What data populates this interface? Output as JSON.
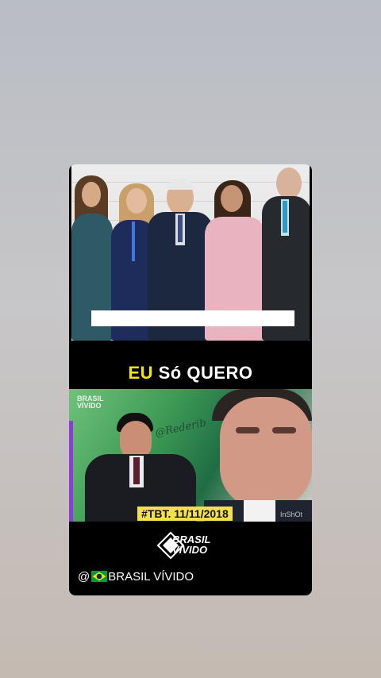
{
  "headline": {
    "part1": "EU",
    "part2": "Só",
    "part3": "QUERO"
  },
  "overlay": {
    "watermark_handle": "@Rederib",
    "date_tag": "#TBT.  11/11/2018",
    "corner_mark": "InShOt",
    "small_logo_line1": "BRASIL",
    "small_logo_line2": "VÍVIDO"
  },
  "brand_logo": {
    "line1": "BRASIL",
    "line2": "VÍVIDO"
  },
  "account": {
    "prefix": "@",
    "flag_icon": "brazil-flag-icon",
    "name": "BRASIL VÍVIDO"
  },
  "colors": {
    "accent_yellow": "#f5e600",
    "tag_yellow": "#f4e04d",
    "card_bg": "#000000",
    "flag_green": "#009c3b",
    "flag_yellow": "#ffdf00",
    "flag_blue": "#002776"
  }
}
